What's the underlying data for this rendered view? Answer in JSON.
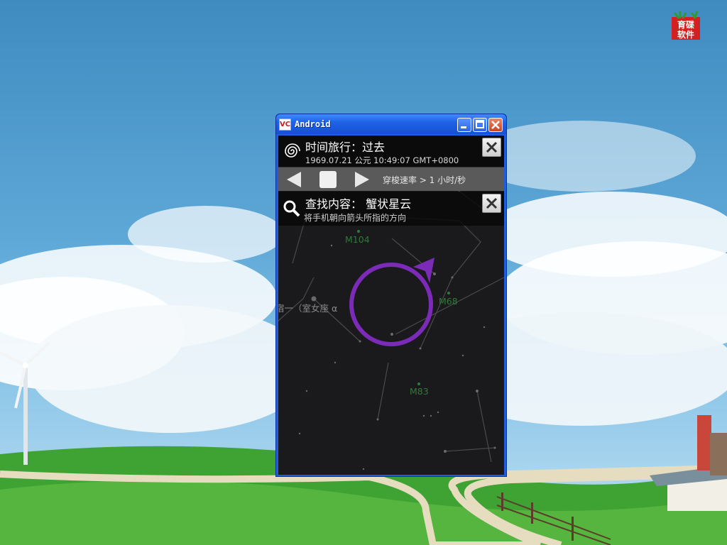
{
  "desktop": {
    "brand_logo_text": "育碟软件",
    "colors": {
      "sky": "#4f9bcf",
      "grass": "#3fa334"
    }
  },
  "window": {
    "title": "Android",
    "app_icon_text": "VC",
    "icons": [
      "minimize-icon",
      "maximize-icon",
      "close-icon"
    ]
  },
  "time_travel": {
    "title": "时间旅行：过去",
    "date": "1969.07.21 公元  10:49:07 GMT+0800",
    "icon": "galaxy-swirl-icon"
  },
  "playback": {
    "rate_label": "穿梭速率 > 1 小时/秒",
    "icons": [
      "rewind-icon",
      "stop-icon",
      "forward-icon"
    ]
  },
  "search": {
    "title": "查找内容： 蟹状星云",
    "hint": "将手机朝向箭头所指的方向",
    "icon": "magnifier-icon"
  },
  "sky_map": {
    "labels": {
      "m104": "M104",
      "m68": "M68",
      "m83": "M83",
      "star": "宿一（室女座 α"
    },
    "colors": {
      "target_ring": "#7b2bb8",
      "object_label": "#2f7a3a"
    }
  }
}
